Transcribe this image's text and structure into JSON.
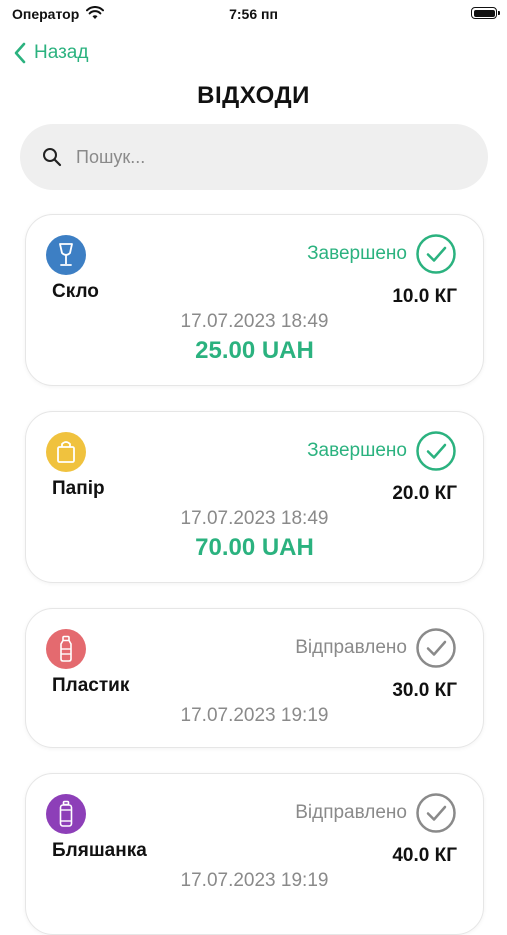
{
  "status_bar": {
    "carrier": "Оператор",
    "time": "7:56 пп"
  },
  "nav": {
    "back_label": "Назад",
    "title": "ВІДХОДИ"
  },
  "search": {
    "placeholder": "Пошук..."
  },
  "colors": {
    "accent": "#2bb27f",
    "muted": "#8a8a8a",
    "glass": "#3d7fc4",
    "paper": "#f0c23e",
    "plastic": "#e46a6f",
    "can": "#8d3fb8"
  },
  "orders": [
    {
      "category": "Скло",
      "icon": "wine-glass-icon",
      "status": "Завершено",
      "status_icon": "check-circle-icon",
      "weight": "10.0 КГ",
      "date": "17.07.2023 18:49",
      "amount": "25.00 UAH"
    },
    {
      "category": "Папір",
      "icon": "paper-bag-icon",
      "status": "Завершено",
      "status_icon": "check-circle-icon",
      "weight": "20.0 КГ",
      "date": "17.07.2023 18:49",
      "amount": "70.00 UAH"
    },
    {
      "category": "Пластик",
      "icon": "plastic-bottle-icon",
      "status": "Відправлено",
      "status_icon": "check-circle-icon",
      "weight": "30.0 КГ",
      "date": "17.07.2023 19:19"
    },
    {
      "category": "Бляшанка",
      "icon": "can-icon",
      "status": "Відправлено",
      "status_icon": "check-circle-icon",
      "weight": "40.0 КГ",
      "date": "17.07.2023 19:19"
    }
  ]
}
